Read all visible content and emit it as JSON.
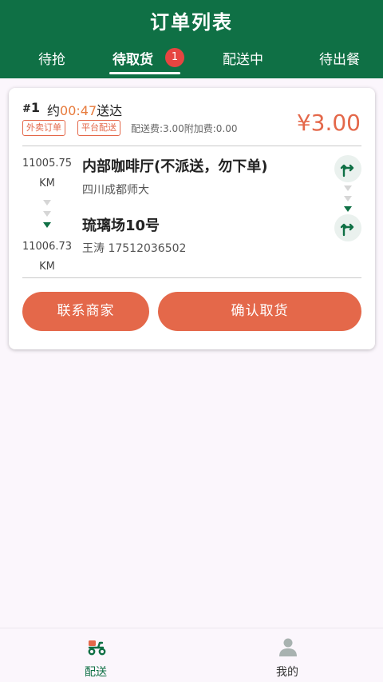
{
  "header": {
    "title": "订单列表",
    "tabs": [
      {
        "label": "待抢"
      },
      {
        "label": "待取货",
        "active": true,
        "badge": "1"
      },
      {
        "label": "配送中"
      },
      {
        "label": "待出餐"
      }
    ]
  },
  "order": {
    "number_prefix": "#",
    "number": "1",
    "eta_prefix": "约",
    "eta_time": "00:47",
    "eta_suffix": "送达",
    "tags": [
      "外卖订单",
      "平台配送"
    ],
    "fee_text": "配送费:3.00附加费:0.00",
    "price": "¥3.00",
    "pickup": {
      "distance": "11005.75",
      "unit": "KM",
      "name": "内部咖啡厅(不派送，勿下单)",
      "address": "四川成都师大"
    },
    "dropoff": {
      "distance": "11006.73",
      "unit": "KM",
      "name": "琉璃场10号",
      "contact": "王涛 17512036502"
    },
    "buttons": {
      "contact_merchant": "联系商家",
      "confirm_pickup": "确认取货"
    }
  },
  "bottom_nav": {
    "items": [
      {
        "label": "配送",
        "icon": "scooter-icon",
        "active": true
      },
      {
        "label": "我的",
        "icon": "person-icon",
        "active": false
      }
    ]
  },
  "colors": {
    "brand_green": "#0f7045",
    "accent_orange": "#e4684a",
    "time_orange": "#e77a3b",
    "badge_red": "#e64541"
  }
}
